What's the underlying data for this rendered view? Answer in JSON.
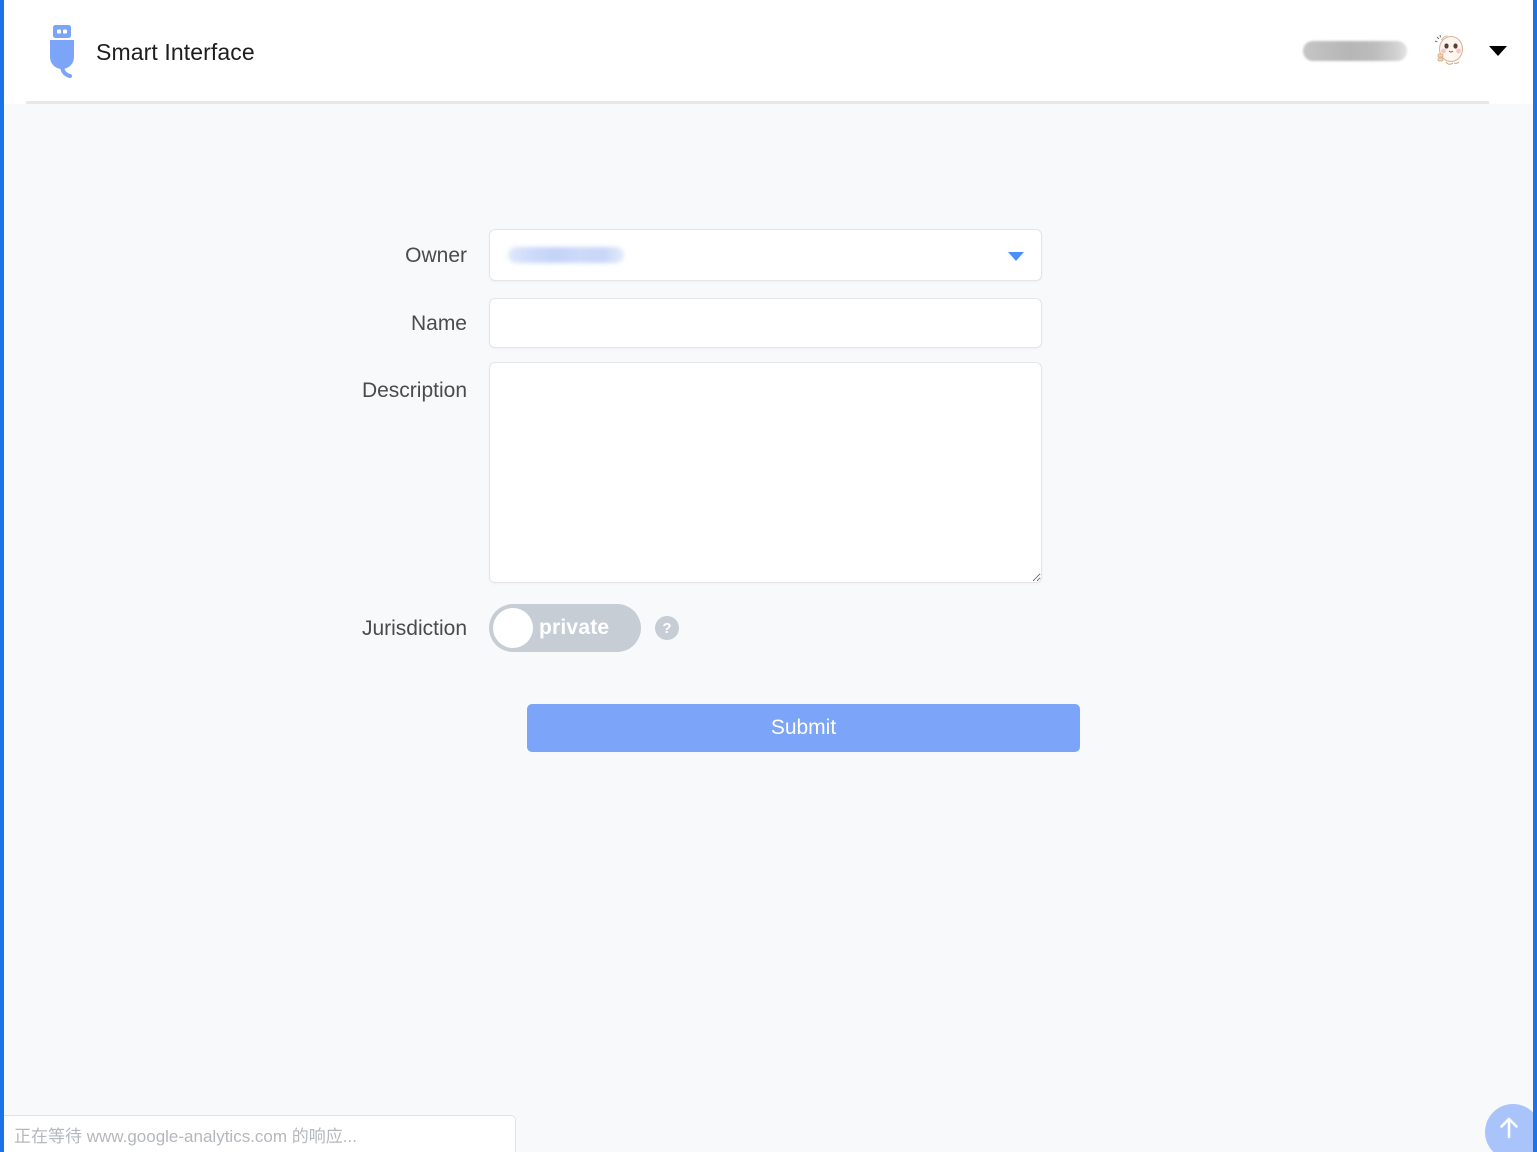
{
  "header": {
    "brand_title": "Smart Interface",
    "logo_icon": "usb-plug-icon",
    "username_redacted": "",
    "avatar_icon": "hamster-avatar",
    "chevron_icon": "chevron-down-icon"
  },
  "form": {
    "owner": {
      "label": "Owner",
      "value_redacted": "",
      "caret_icon": "dropdown-caret-icon"
    },
    "name": {
      "label": "Name",
      "value": "",
      "placeholder": ""
    },
    "description": {
      "label": "Description",
      "value": "",
      "placeholder": ""
    },
    "jurisdiction": {
      "label": "Jurisdiction",
      "toggle_state": "private",
      "help_icon": "question-mark-icon",
      "help_glyph": "?"
    },
    "submit_label": "Submit"
  },
  "scroll_top": {
    "icon": "arrow-up-icon"
  },
  "statusbar": {
    "text": "正在等待 www.google-analytics.com 的响应..."
  },
  "colors": {
    "brand_blue": "#7ca4f8",
    "accent_caret": "#4a90f7",
    "toggle_grey": "#c7cdd4",
    "page_bg": "#f7f9fb",
    "window_border": "#1a73e8",
    "label_text": "#4b4b4b",
    "status_text": "#b4b8bc"
  }
}
